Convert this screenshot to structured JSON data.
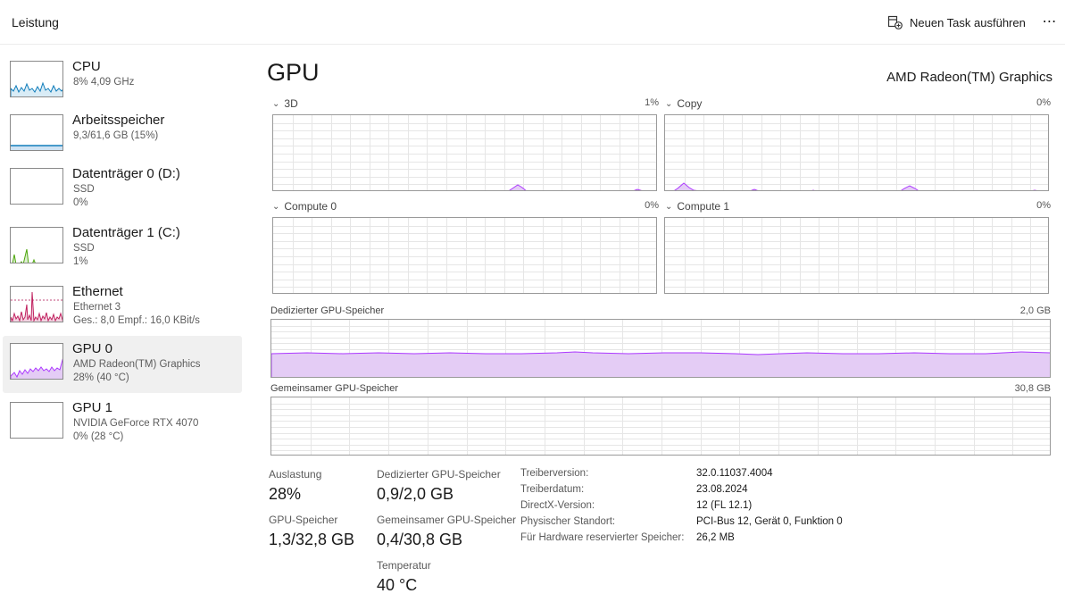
{
  "header": {
    "title": "Leistung",
    "new_task_label": "Neuen Task ausführen",
    "more_label": "⋯"
  },
  "sidebar": {
    "items": [
      {
        "name": "CPU",
        "sub1": "8%  4,09 GHz",
        "sub2": "",
        "color": "#117dbb"
      },
      {
        "name": "Arbeitsspeicher",
        "sub1": "9,3/61,6 GB (15%)",
        "sub2": "",
        "color": "#8b12ae"
      },
      {
        "name": "Datenträger 0 (D:)",
        "sub1": "SSD",
        "sub2": "0%",
        "color": "#4da60c"
      },
      {
        "name": "Datenträger 1 (C:)",
        "sub1": "SSD",
        "sub2": "1%",
        "color": "#4da60c"
      },
      {
        "name": "Ethernet",
        "sub1": "Ethernet 3",
        "sub2": "Ges.: 8,0  Empf.: 16,0 KBit/s",
        "color": "#a74f01"
      },
      {
        "name": "GPU 0",
        "sub1": "AMD Radeon(TM) Graphics",
        "sub2": "28%  (40 °C)",
        "color": "#ac39ff"
      },
      {
        "name": "GPU 1",
        "sub1": "NVIDIA GeForce RTX 4070",
        "sub2": "0%  (28 °C)",
        "color": "#ac39ff"
      }
    ],
    "active_index": 5
  },
  "main": {
    "title": "GPU",
    "device": "AMD Radeon(TM) Graphics",
    "engines": [
      {
        "label": "3D",
        "pct": "1%"
      },
      {
        "label": "Copy",
        "pct": "0%"
      },
      {
        "label": "Compute 0",
        "pct": "0%"
      },
      {
        "label": "Compute 1",
        "pct": "0%"
      }
    ],
    "dedicated_mem": {
      "label": "Dedizierter GPU-Speicher",
      "max": "2,0 GB",
      "usage_fraction": 0.45
    },
    "shared_mem": {
      "label": "Gemeinsamer GPU-Speicher",
      "max": "30,8 GB",
      "usage_fraction": 0.0
    },
    "stats": {
      "auslastung_label": "Auslastung",
      "auslastung_value": "28%",
      "gpu_mem_label": "GPU-Speicher",
      "gpu_mem_value": "1,3/32,8 GB",
      "ded_label": "Dedizierter GPU-Speicher",
      "ded_value": "0,9/2,0 GB",
      "shared_label": "Gemeinsamer GPU-Speicher",
      "shared_value": "0,4/30,8 GB",
      "temp_label": "Temperatur",
      "temp_value": "40 °C"
    },
    "info": [
      {
        "key": "Treiberversion:",
        "value": "32.0.11037.4004"
      },
      {
        "key": "Treiberdatum:",
        "value": "23.08.2024"
      },
      {
        "key": "DirectX-Version:",
        "value": "12 (FL 12.1)"
      },
      {
        "key": "Physischer Standort:",
        "value": "PCI-Bus 12, Gerät 0, Funktion 0"
      },
      {
        "key": "Für Hardware reservierter Speicher:",
        "value": "26,2 MB"
      }
    ]
  },
  "colors": {
    "gpu_line": "#ac39ff",
    "gpu_fill": "#e4ccf5",
    "grid": "#e6e6e6"
  }
}
